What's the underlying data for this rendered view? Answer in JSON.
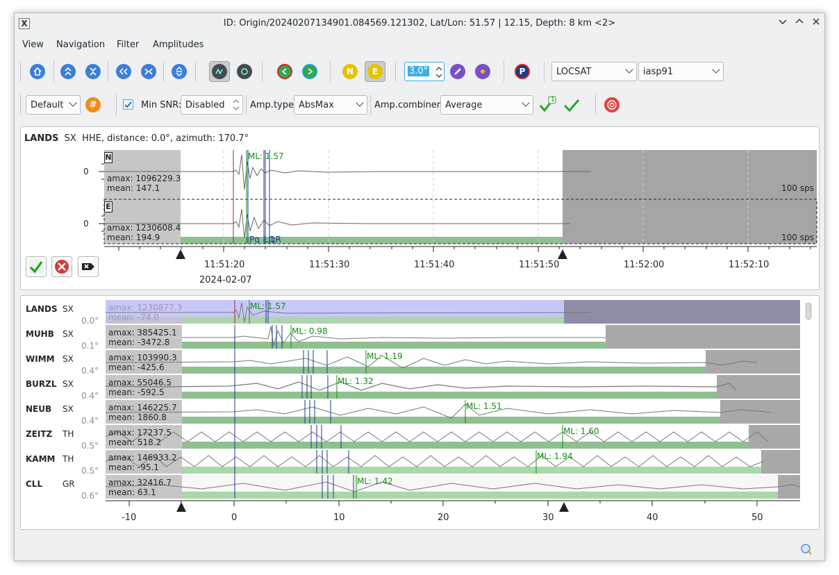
{
  "window": {
    "app_icon": "X",
    "title": "ID: Origin/20240207134901.084569.121302, Lat/Lon: 51.57 | 12.15, Depth: 8 km <2>",
    "controls": [
      "chevron-down-icon",
      "chevron-up-icon",
      "close-icon"
    ]
  },
  "menubar": [
    "View",
    "Navigation",
    "Filter",
    "Amplitudes"
  ],
  "toolbar1": {
    "buttons": [
      "home-icon",
      "nav-up-icon",
      "nav-collapse-icon",
      "nav-left-icon",
      "nav-center-icon",
      "nav-vertical-icon",
      "waveform-pick-icon",
      "waveform-settings-icon",
      "prev-green-icon",
      "next-green-icon",
      "n-component-icon",
      "e-component-icon",
      "amplitude-pick-icon",
      "amplitude-clear-icon",
      "p-phase-icon"
    ],
    "component_n": "N",
    "component_e": "E",
    "p_label": "P",
    "spin_value": "3.0°",
    "locator": "LOCSAT",
    "profile": "iasp91"
  },
  "toolbar2": {
    "preset": "Default",
    "hash_label": "#",
    "min_snr_label": "Min SNR:",
    "min_snr_checked": true,
    "min_snr_value": "Disabled",
    "amp_type_label": "Amp.type:",
    "amp_type_value": "AbsMax",
    "amp_combiner_label": "Amp.combiner:",
    "amp_combiner_value": "Average",
    "badge": "1"
  },
  "detail": {
    "header_station": "LANDS",
    "header_net": "SX",
    "header_info": "HHE, distance: 0.0°, azimuth: 170.7°",
    "traces": [
      {
        "comp": "N",
        "amax": "amax: 1096229.3",
        "mean": "mean: 147.1",
        "sps": "100 sps",
        "zero": "0"
      },
      {
        "comp": "E",
        "amax": "amax: 1230608.4",
        "mean": "mean: 194.9",
        "sps": "100 sps",
        "zero": "0"
      }
    ],
    "ml_label": "ML: 1.57",
    "phase_labels": [
      "Pq",
      "LQ",
      "LR"
    ],
    "time_ticks": [
      "11:51:20",
      "11:51:30",
      "11:51:40",
      "11:51:50",
      "11:52:00",
      "11:52:10"
    ],
    "date": "2024-02-07"
  },
  "stations": [
    {
      "name": "LANDS",
      "net": "SX",
      "dist": "0.0°",
      "amax": "amax: 1230877.3",
      "mean": "mean: -74.0",
      "ml": "ML: 1.57"
    },
    {
      "name": "MUHB",
      "net": "SX",
      "dist": "0.1°",
      "amax": "amax: 385425.1",
      "mean": "mean: -3472.8",
      "ml": "ML: 0.98"
    },
    {
      "name": "WIMM",
      "net": "SX",
      "dist": "0.4°",
      "amax": "amax: 103990.3",
      "mean": "mean: -425.6",
      "ml": "ML: 1.19"
    },
    {
      "name": "BURZL",
      "net": "SX",
      "dist": "0.4°",
      "amax": "amax: 55046.5",
      "mean": "mean: -592.5",
      "ml": "ML: 1.32"
    },
    {
      "name": "NEUB",
      "net": "SX",
      "dist": "0.4°",
      "amax": "amax: 146225.7",
      "mean": "mean: 1860.8",
      "ml": "ML: 1.51"
    },
    {
      "name": "ZEITZ",
      "net": "TH",
      "dist": "0.5°",
      "amax": "amax: 17237.5",
      "mean": "mean: 518.2",
      "ml": "ML: 1.60"
    },
    {
      "name": "KAMM",
      "net": "TH",
      "dist": "0.5°",
      "amax": "amax: 146933.2",
      "mean": "mean: -95.1",
      "ml": "ML: 1.94"
    },
    {
      "name": "CLL",
      "net": "GR",
      "dist": "0.6°",
      "amax": "amax: 32416.7",
      "mean": "mean: 63.1",
      "ml": "ML: 1.42"
    }
  ],
  "overview_axis": [
    "-10",
    "0",
    "10",
    "20",
    "30",
    "40",
    "50"
  ],
  "colors": {
    "selected": "#c8c8f8",
    "green": "#8fc08f",
    "gray": "#a8a8a8",
    "ml": "#109010",
    "phase": "#1a3a8a"
  }
}
